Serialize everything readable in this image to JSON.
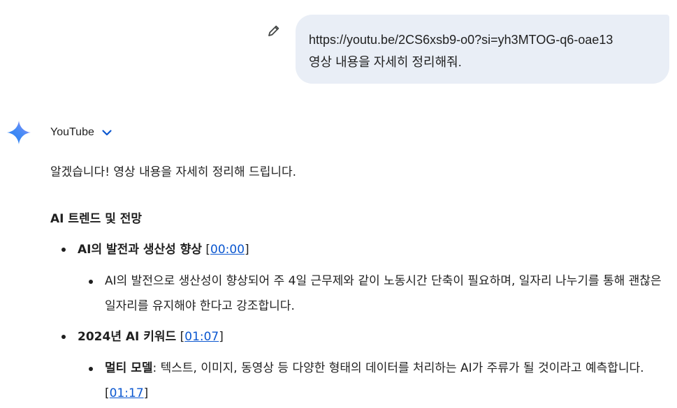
{
  "user_message": {
    "line1": "https://youtu.be/2CS6xsb9-o0?si=yh3MTOG-q6-oae13",
    "line2": "영상 내용을 자세히 정리해줘."
  },
  "response": {
    "source_label": "YouTube",
    "intro": "알겠습니다! 영상 내용을 자세히 정리해 드립니다.",
    "section_heading": "AI 트렌드 및 전망",
    "items": [
      {
        "title": "AI의 발전과 생산성 향상",
        "timestamp": "00:00",
        "sub_text": "AI의 발전으로 생산성이 향상되어 주 4일 근무제와 같이 노동시간 단축이 필요하며, 일자리 나누기를 통해 괜찮은 일자리를 유지해야 한다고 강조합니다."
      },
      {
        "title": "2024년 AI 키워드",
        "timestamp": "01:07",
        "sub_title": "멀티 모델",
        "sub_text": ": 텍스트, 이미지, 동영상 등 다양한 형태의 데이터를 처리하는 AI가 주류가 될 것이라고 예측합니다.",
        "sub_timestamp": "01:17"
      }
    ]
  },
  "colors": {
    "bubble_bg": "#e9eef6",
    "link": "#0b57d0",
    "chevron": "#0b57d0",
    "text": "#1f1f1f"
  },
  "icons": {
    "edit": "pencil-icon",
    "assistant": "gemini-spark-icon",
    "expand": "chevron-down-icon"
  }
}
